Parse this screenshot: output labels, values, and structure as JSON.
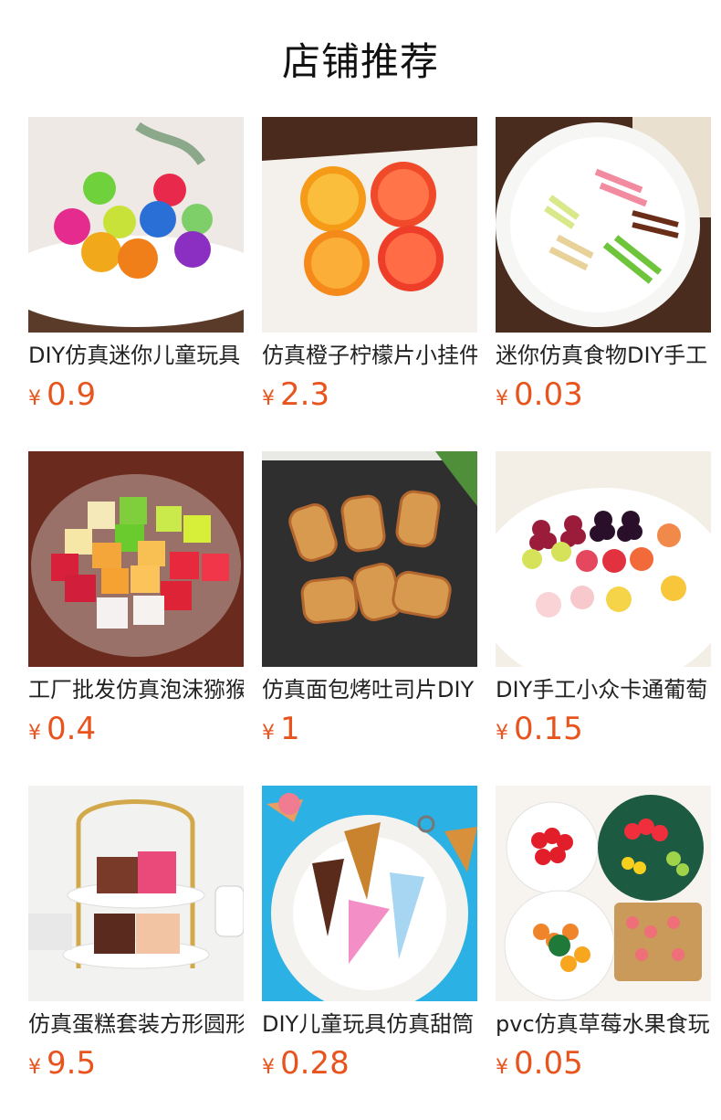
{
  "header": {
    "title": "店铺推荐"
  },
  "products": [
    {
      "name": "DIY仿真迷你儿童玩具",
      "currency": "¥",
      "price": "0.9",
      "image": "colorful-felt-balls-on-plate"
    },
    {
      "name": "仿真橙子柠檬片小挂件",
      "currency": "¥",
      "price": "2.3",
      "image": "orange-slices-on-white-board"
    },
    {
      "name": "迷你仿真食物DIY手工",
      "currency": "¥",
      "price": "0.03",
      "image": "candy-sticks-on-white-plate"
    },
    {
      "name": "工厂批发仿真泡沫猕猴桃",
      "currency": "¥",
      "price": "0.4",
      "image": "fruit-cubes-on-glass-plate"
    },
    {
      "name": "仿真面包烤吐司片DIY",
      "currency": "¥",
      "price": "1",
      "image": "toast-slices-on-slate"
    },
    {
      "name": "DIY手工小众卡通葡萄",
      "currency": "¥",
      "price": "0.15",
      "image": "grapes-and-fruits-on-plate"
    },
    {
      "name": "仿真蛋糕套装方形圆形",
      "currency": "¥",
      "price": "9.5",
      "image": "cake-stand-with-cakes"
    },
    {
      "name": "DIY儿童玩具仿真甜筒",
      "currency": "¥",
      "price": "0.28",
      "image": "ice-cream-cones-on-plate"
    },
    {
      "name": "pvc仿真草莓水果食玩",
      "currency": "¥",
      "price": "0.05",
      "image": "fruit-pieces-on-plates"
    }
  ],
  "colors": {
    "price": "#e8541e",
    "title": "#111111",
    "text": "#222222"
  }
}
